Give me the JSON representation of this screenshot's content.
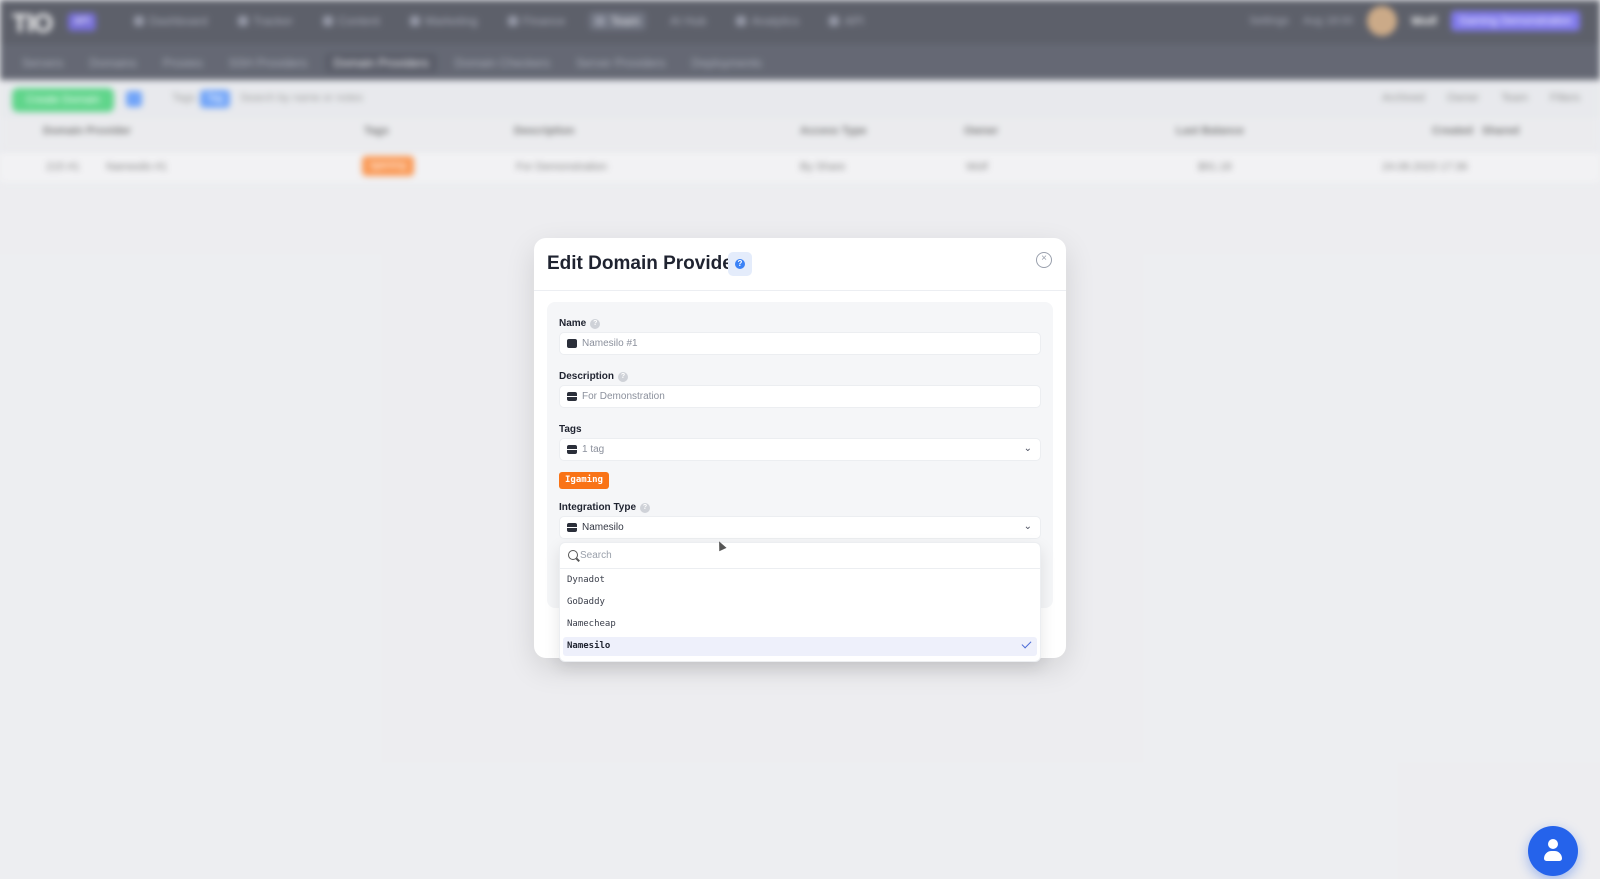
{
  "app": {
    "logo": "TIO",
    "logo_badge": "API",
    "nav": [
      "Dashboard",
      "Tracker",
      "Content",
      "Marketing",
      "Finance",
      "Team",
      "AI Hub",
      "Analytics",
      "API"
    ],
    "nav_active_index": 5,
    "top_right": [
      "Settings",
      "Aug 18:00"
    ],
    "user_name": "Wolf",
    "user_badge": "Gaming Demonstration",
    "subnav": [
      "Servers",
      "Domains",
      "Proxies",
      "SSH Providers",
      "Domain Providers",
      "Domain Checkers",
      "Server Providers",
      "Deployments"
    ],
    "subnav_active_index": 4,
    "toolbar": {
      "create_label": "Create Domain",
      "tags_label": "Tags",
      "tags_pill": "Tag",
      "search_placeholder": "Search by name or notes",
      "right": [
        "Archived",
        "Owner",
        "Team",
        "Filters"
      ]
    },
    "table": {
      "headers": [
        "Domain Provider",
        "Tags",
        "Description",
        "Access Type",
        "Owner",
        "Last Balance",
        "Created",
        "Shared"
      ],
      "row": {
        "id": "215 #1",
        "name": "Namesilo #1",
        "tag": "Igaming",
        "description": "For Demonstration",
        "access": "By Share",
        "owner": "Wolf",
        "balance": "$91.18",
        "created": "24.08.2023 17:36"
      }
    }
  },
  "modal": {
    "title": "Edit Domain Provider",
    "close_glyph": "×",
    "help_glyph": "?",
    "fields": {
      "name": {
        "label": "Name",
        "value": "Namesilo #1"
      },
      "description": {
        "label": "Description",
        "value": "For Demonstration"
      },
      "tags": {
        "label": "Tags",
        "value": "1 tag",
        "chip": "Igaming"
      },
      "integration_type": {
        "label": "Integration Type",
        "value": "Namesilo"
      }
    },
    "chevron": "⌄"
  },
  "dropdown": {
    "search_placeholder": "Search",
    "options": [
      "Dynadot",
      "GoDaddy",
      "Namecheap",
      "Namesilo"
    ],
    "selected": "Namesilo"
  },
  "colors": {
    "accent": "#3b82f6",
    "success": "#22c55e",
    "tag": "#f97316",
    "topbar": "#1f2331"
  }
}
